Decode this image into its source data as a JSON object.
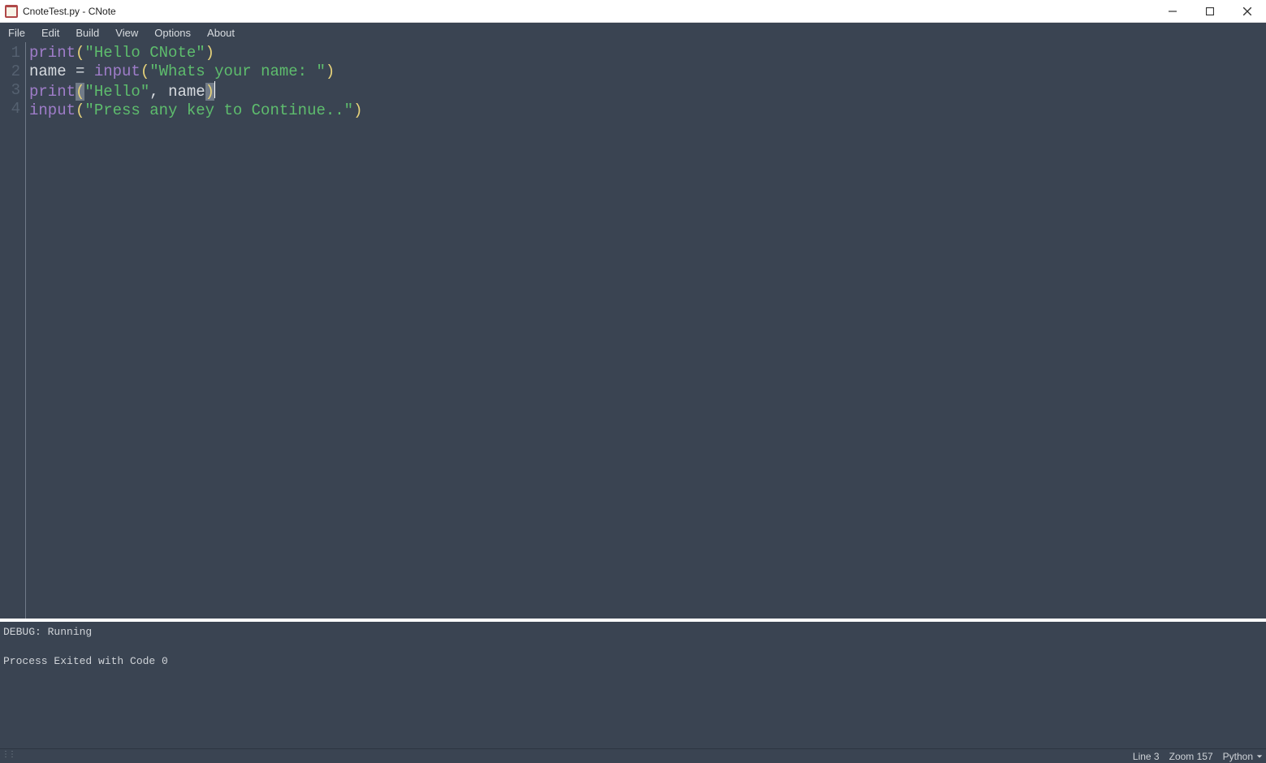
{
  "title": "CnoteTest.py - CNote",
  "menu": {
    "items": [
      "File",
      "Edit",
      "Build",
      "View",
      "Options",
      "About"
    ]
  },
  "code": {
    "lines": [
      {
        "num": "1",
        "tokens": [
          {
            "t": "print",
            "c": "tok-fn"
          },
          {
            "t": "(",
            "c": "tok-punc"
          },
          {
            "t": "\"Hello CNote\"",
            "c": "tok-str"
          },
          {
            "t": ")",
            "c": "tok-punc"
          }
        ]
      },
      {
        "num": "2",
        "tokens": [
          {
            "t": "name",
            "c": "tok-ident"
          },
          {
            "t": " = ",
            "c": "tok-op"
          },
          {
            "t": "input",
            "c": "tok-fn"
          },
          {
            "t": "(",
            "c": "tok-punc"
          },
          {
            "t": "\"Whats your name: \"",
            "c": "tok-str"
          },
          {
            "t": ")",
            "c": "tok-punc"
          }
        ]
      },
      {
        "num": "3",
        "tokens": [
          {
            "t": "print",
            "c": "tok-fn"
          },
          {
            "t": "(",
            "c": "tok-brkt"
          },
          {
            "t": "\"Hello\"",
            "c": "tok-str"
          },
          {
            "t": ", ",
            "c": "tok-op"
          },
          {
            "t": "name",
            "c": "tok-ident"
          },
          {
            "t": ")",
            "c": "tok-brkt"
          },
          {
            "t": "",
            "c": "cursor-marker"
          }
        ]
      },
      {
        "num": "4",
        "tokens": [
          {
            "t": "input",
            "c": "tok-fn"
          },
          {
            "t": "(",
            "c": "tok-punc"
          },
          {
            "t": "\"Press any key to Continue..\"",
            "c": "tok-str"
          },
          {
            "t": ")",
            "c": "tok-punc"
          }
        ]
      }
    ]
  },
  "output": {
    "lines": [
      "DEBUG: Running",
      "",
      "Process Exited with Code 0"
    ]
  },
  "status": {
    "line": "Line 3",
    "zoom": "Zoom 157",
    "language": "Python"
  }
}
